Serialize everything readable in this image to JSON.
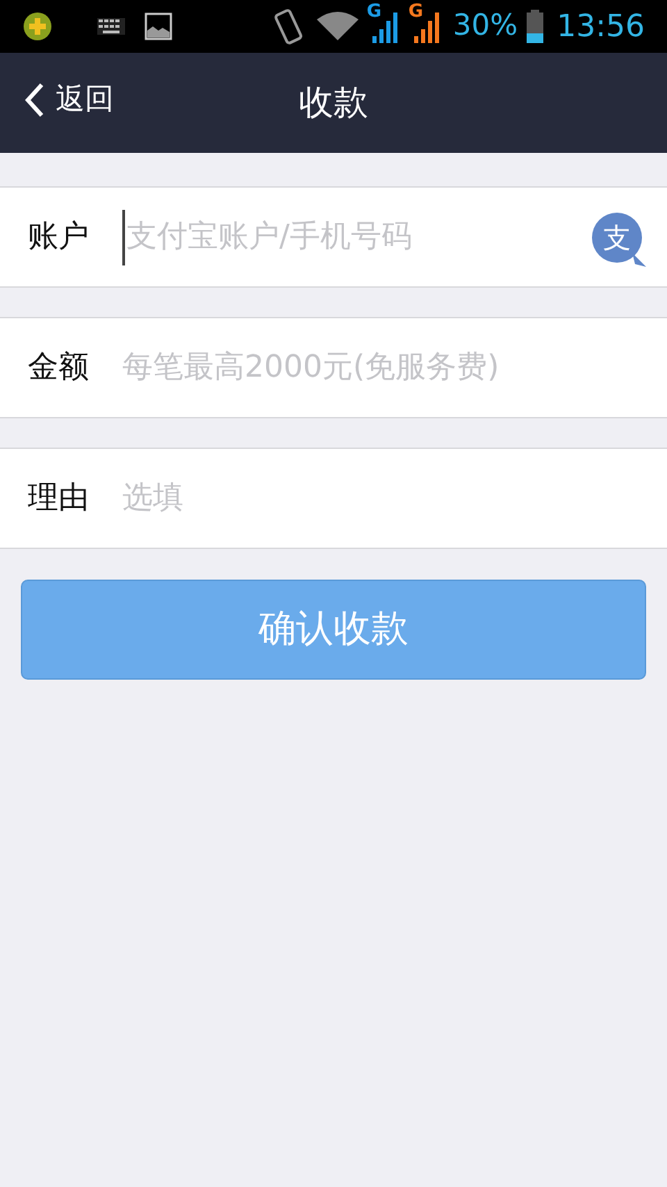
{
  "status_bar": {
    "signals": [
      {
        "label": "G",
        "color": "#1c9ce6"
      },
      {
        "label": "G",
        "color": "#f5781e"
      }
    ],
    "battery": "30%",
    "time": "13:56"
  },
  "header": {
    "back": "返回",
    "title": "收款"
  },
  "fields": [
    {
      "label": "账户",
      "placeholder": "支付宝账户/手机号码",
      "focused": true,
      "badge": "支"
    },
    {
      "label": "金额",
      "placeholder": "每笔最高2000元(免服务费)",
      "focused": false
    },
    {
      "label": "理由",
      "placeholder": "选填",
      "focused": false
    }
  ],
  "submit": "确认收款"
}
